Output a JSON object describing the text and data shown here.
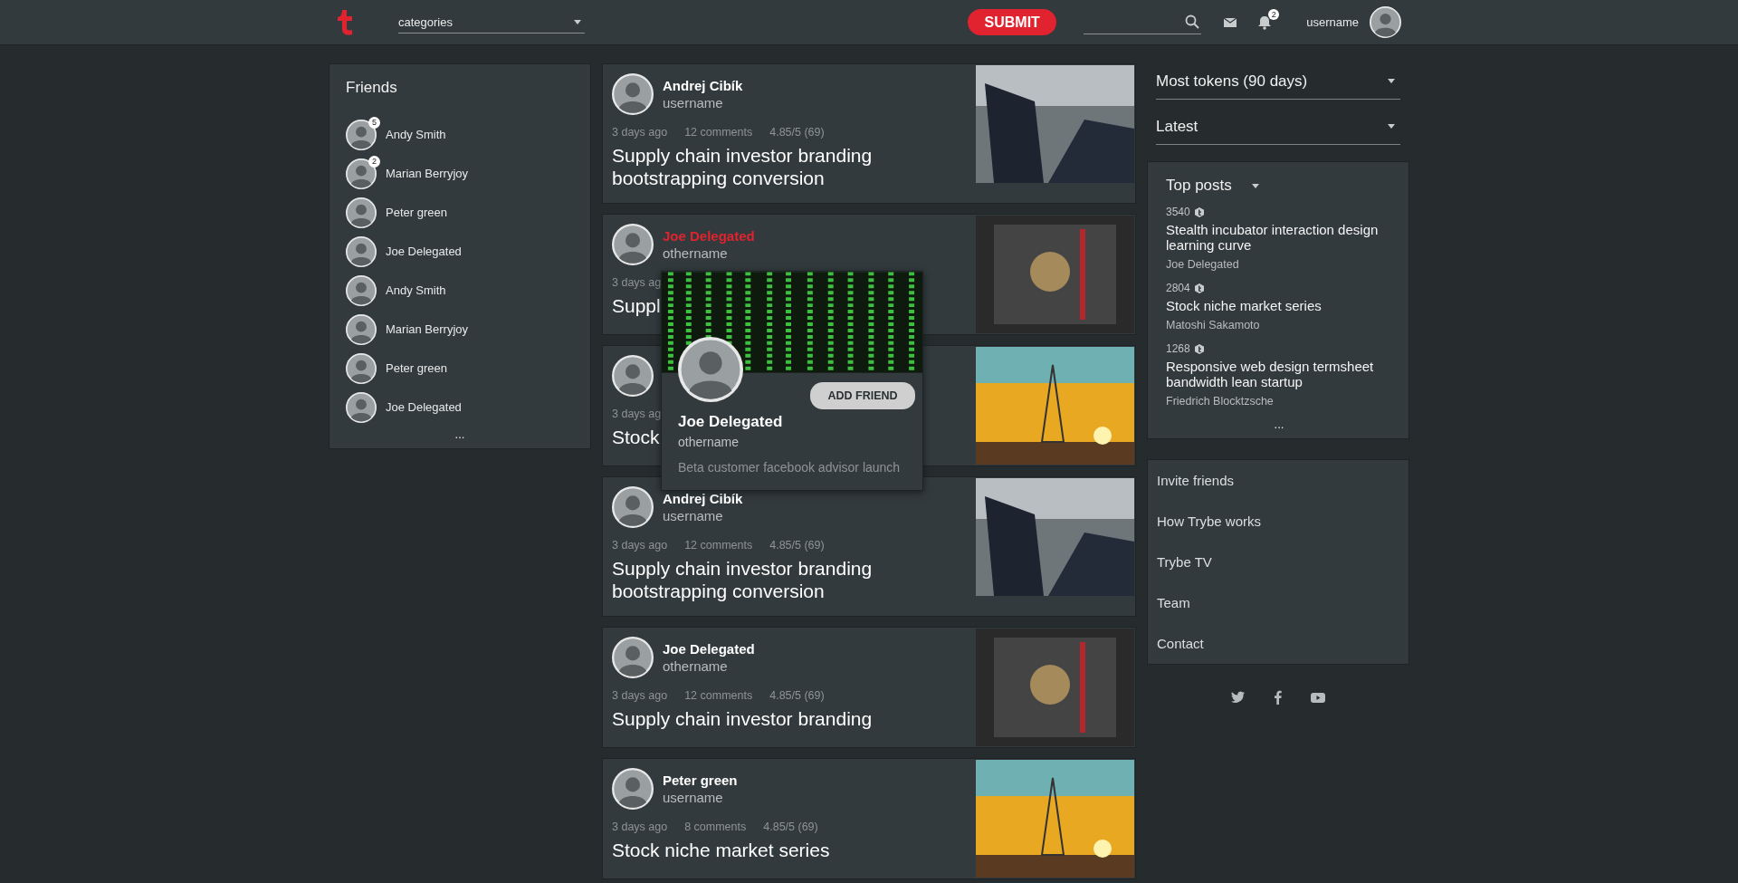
{
  "header": {
    "categories": {
      "value": "categories"
    },
    "submit": "SUBMIT",
    "notifications": "2",
    "username": "username"
  },
  "friends": {
    "title": "Friends",
    "items": [
      {
        "name": "Andy Smith",
        "badge": "5"
      },
      {
        "name": "Marian Berryjoy",
        "badge": "2"
      },
      {
        "name": "Peter green"
      },
      {
        "name": "Joe Delegated"
      },
      {
        "name": "Andy Smith"
      },
      {
        "name": "Marian Berryjoy"
      },
      {
        "name": "Peter green"
      },
      {
        "name": "Joe Delegated"
      }
    ],
    "more": "..."
  },
  "posts": [
    {
      "author": "Andrej Cibík",
      "handle": "username",
      "hovered": false,
      "meta": [
        "3 days ago",
        "12 comments",
        "4.85/5 (69)"
      ],
      "title": "Supply chain investor branding bootstrapping conversion",
      "kind": "solar"
    },
    {
      "author": "Joe Delegated",
      "handle": "othername",
      "hovered": true,
      "meta": [
        "3 days ag"
      ],
      "title": "Suppl",
      "kind": "chip"
    },
    {
      "meta": [
        "3 days ag"
      ],
      "title": "Stock",
      "kind": "tower"
    },
    {
      "author": "Andrej Cibík",
      "handle": "username",
      "hovered": false,
      "meta": [
        "3 days ago",
        "12 comments",
        "4.85/5 (69)"
      ],
      "title": "Supply chain investor branding bootstrapping conversion",
      "kind": "solar"
    },
    {
      "author": "Joe Delegated",
      "handle": "othername",
      "hovered": false,
      "meta": [
        "3 days ago",
        "12 comments",
        "4.85/5 (69)"
      ],
      "title": "Supply chain investor branding",
      "kind": "chip"
    },
    {
      "author": "Peter green",
      "handle": "username",
      "hovered": false,
      "meta": [
        "3 days ago",
        "8 comments",
        "4.85/5 (69)"
      ],
      "title": "Stock niche market series",
      "kind": "tower"
    }
  ],
  "profile_popup": {
    "name": "Joe Delegated",
    "handle": "othername",
    "bio": "Beta customer facebook advisor launch",
    "button": "ADD FRIEND"
  },
  "filters": [
    {
      "label": "Most tokens (90 days)"
    },
    {
      "label": "Latest"
    }
  ],
  "top_posts": {
    "title": "Top posts",
    "items": [
      {
        "tokens": "3540",
        "title": "Stealth incubator interaction design learning curve",
        "author": "Joe Delegated"
      },
      {
        "tokens": "2804",
        "title": "Stock niche market series",
        "author": "Matoshi Sakamoto"
      },
      {
        "tokens": "1268",
        "title": "Responsive web design termsheet bandwidth lean startup",
        "author": "Friedrich Blocktzsche"
      }
    ],
    "more": "..."
  },
  "links": [
    "Invite friends",
    "How Trybe works",
    "Trybe TV",
    "Team",
    "Contact"
  ]
}
